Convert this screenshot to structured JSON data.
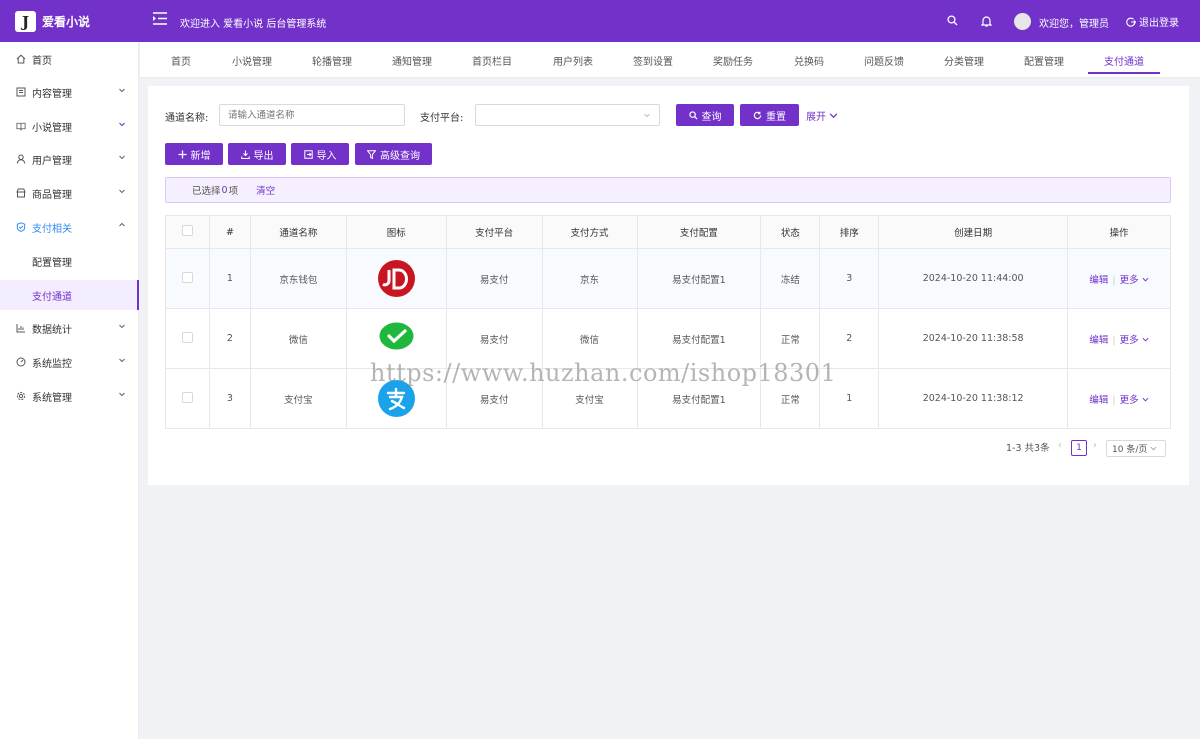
{
  "header": {
    "logo_letter": "J",
    "app_name": "爱看小说",
    "welcome_system": "欢迎进入 爱看小说 后台管理系统",
    "user_greeting": "欢迎您，管理员",
    "logout": "退出登录"
  },
  "sidebar": {
    "items": [
      {
        "label": "首页"
      },
      {
        "label": "内容管理"
      },
      {
        "label": "小说管理"
      },
      {
        "label": "用户管理"
      },
      {
        "label": "商品管理"
      },
      {
        "label": "支付相关"
      },
      {
        "label": "配置管理"
      },
      {
        "label": "支付通道"
      },
      {
        "label": "数据统计"
      },
      {
        "label": "系统监控"
      },
      {
        "label": "系统管理"
      }
    ]
  },
  "tabs": [
    "首页",
    "小说管理",
    "轮播管理",
    "通知管理",
    "首页栏目",
    "用户列表",
    "签到设置",
    "奖励任务",
    "兑换码",
    "问题反馈",
    "分类管理",
    "配置管理",
    "支付通道"
  ],
  "search": {
    "name_label": "通道名称:",
    "name_placeholder": "请输入通道名称",
    "platform_label": "支付平台:",
    "query": "查询",
    "reset": "重置",
    "expand": "展开"
  },
  "toolbar": {
    "add": "新增",
    "export": "导出",
    "import": "导入",
    "advanced": "高级查询"
  },
  "selection": {
    "prefix": "已选择 ",
    "count": "0",
    "suffix": "项",
    "clear": "清空"
  },
  "table": {
    "headers": [
      "#",
      "通道名称",
      "图标",
      "支付平台",
      "支付方式",
      "支付配置",
      "状态",
      "排序",
      "创建日期",
      "操作"
    ],
    "rows": [
      {
        "idx": "1",
        "name": "京东钱包",
        "icon": "jd-logo",
        "platform": "易支付",
        "method": "京东",
        "config": "易支付配置1",
        "status": "冻结",
        "sort": "3",
        "date": "2024-10-20 11:44:00",
        "edit": "编辑",
        "more": "更多"
      },
      {
        "idx": "2",
        "name": "微信",
        "icon": "wechat-logo",
        "platform": "易支付",
        "method": "微信",
        "config": "易支付配置1",
        "status": "正常",
        "sort": "2",
        "date": "2024-10-20 11:38:58",
        "edit": "编辑",
        "more": "更多"
      },
      {
        "idx": "3",
        "name": "支付宝",
        "icon": "alipay-logo",
        "platform": "易支付",
        "method": "支付宝",
        "config": "易支付配置1",
        "status": "正常",
        "sort": "1",
        "date": "2024-10-20 11:38:12",
        "edit": "编辑",
        "more": "更多"
      }
    ]
  },
  "pagination": {
    "summary": "1-3 共3条",
    "current": "1",
    "page_size": "10 条/页"
  },
  "watermark": "https://www.huzhan.com/ishop18301",
  "colors": {
    "primary": "#7232c9",
    "jd": "#c91521",
    "wechat": "#20b83c",
    "alipay": "#1aa3ea"
  }
}
